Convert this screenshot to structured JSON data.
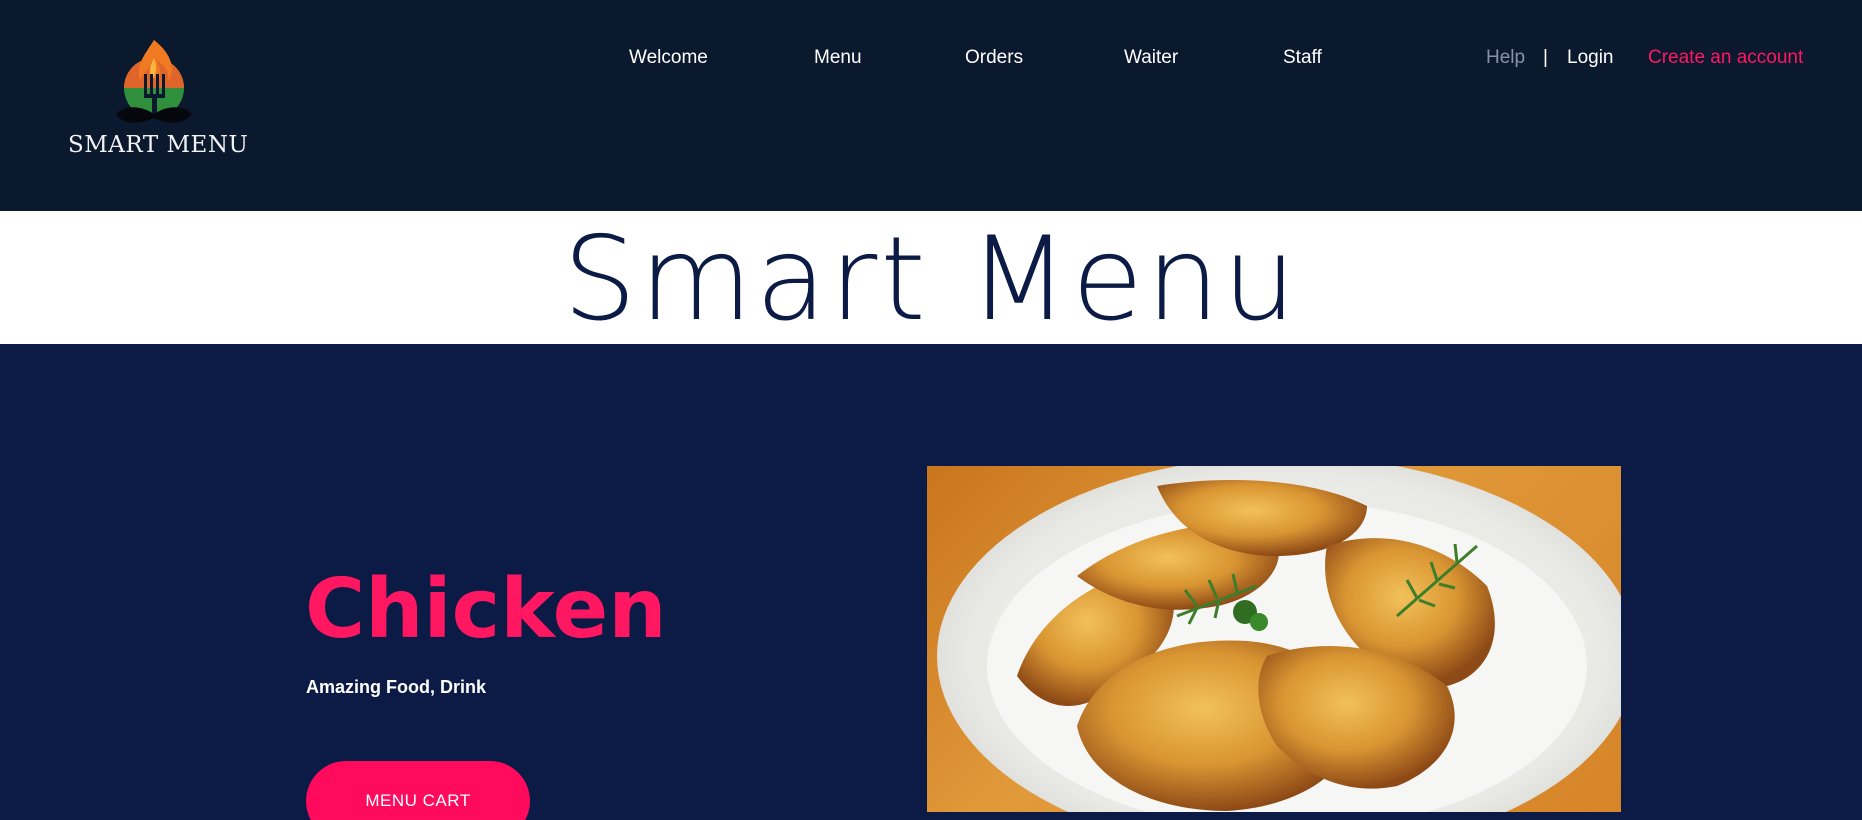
{
  "brand": {
    "logo_text": "SMART MENU",
    "logo_icon": "fork-flame-mustache-icon"
  },
  "nav": {
    "welcome": "Welcome",
    "menu": "Menu",
    "orders": "Orders",
    "waiter": "Waiter",
    "staff": "Staff",
    "help": "Help",
    "separator": "|",
    "login": "Login",
    "create_account": "Create an account"
  },
  "title_band": {
    "title": "Smart Menu"
  },
  "hero": {
    "title": "Chicken",
    "subtitle": "Amazing Food, Drink",
    "button_label": "MENU CART",
    "image_alt": "plate-of-roasted-chicken-image"
  },
  "colors": {
    "header_bg": "#0b192e",
    "hero_bg": "#0b1b45",
    "accent": "#ff1762",
    "title_text": "#0b1b45",
    "help_text": "#8a93a6"
  }
}
